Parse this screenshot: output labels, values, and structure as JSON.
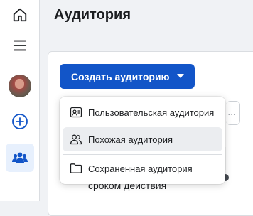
{
  "sidebar": {
    "items": [
      {
        "icon": "home-icon"
      },
      {
        "icon": "menu-icon"
      },
      {
        "icon": "avatar"
      },
      {
        "icon": "plus-circle-icon"
      },
      {
        "icon": "audience-icon",
        "active": true
      }
    ]
  },
  "page": {
    "title": "Аудитория"
  },
  "toolbar": {
    "create_label": "Создать аудиторию"
  },
  "dropdown": {
    "items": [
      {
        "label": "Пользовательская аудитория",
        "icon": "custom-audience-icon"
      },
      {
        "label": "Похожая аудитория",
        "icon": "lookalike-audience-icon"
      },
      {
        "label": "Сохраненная аудитория",
        "icon": "folder-icon"
      }
    ]
  },
  "background": {
    "partial_text": "сроком действия"
  },
  "colors": {
    "accent": "#1255c8",
    "active_bg": "#e7f0fd",
    "page_bg": "#f0f2f5"
  }
}
